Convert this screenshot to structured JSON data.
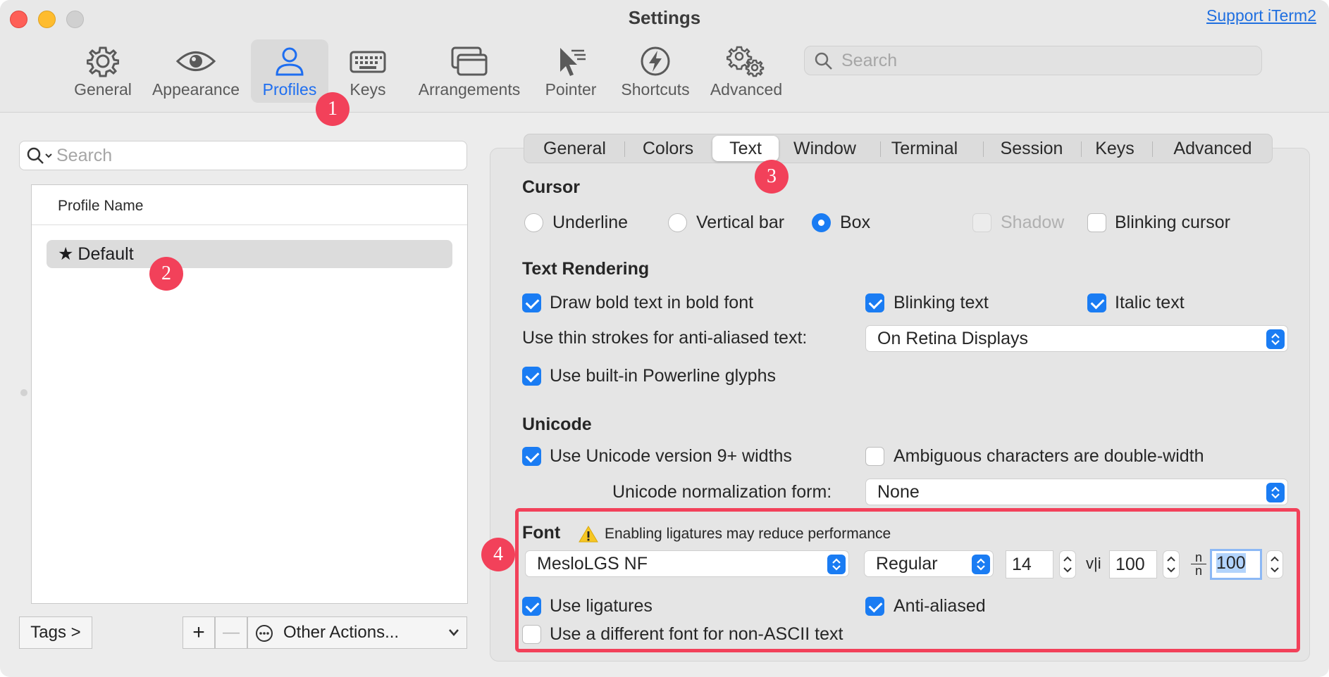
{
  "window": {
    "title": "Settings",
    "support_link": "Support iTerm2"
  },
  "toolbar": {
    "items": [
      {
        "label": "General",
        "icon": "gear-icon"
      },
      {
        "label": "Appearance",
        "icon": "eye-icon"
      },
      {
        "label": "Profiles",
        "icon": "person-icon",
        "active": true
      },
      {
        "label": "Keys",
        "icon": "keyboard-icon"
      },
      {
        "label": "Arrangements",
        "icon": "windows-icon"
      },
      {
        "label": "Pointer",
        "icon": "pointer-icon"
      },
      {
        "label": "Shortcuts",
        "icon": "bolt-icon"
      },
      {
        "label": "Advanced",
        "icon": "gears-icon"
      }
    ],
    "search_placeholder": "Search"
  },
  "annotations": [
    "1",
    "2",
    "3",
    "4"
  ],
  "profiles": {
    "search_placeholder": "Search",
    "column_header": "Profile Name",
    "rows": [
      {
        "name": "Default",
        "default": true
      }
    ],
    "tags_button": "Tags >",
    "add_button": "+",
    "remove_button": "—",
    "other_actions": "Other Actions..."
  },
  "tabs": [
    "General",
    "Colors",
    "Text",
    "Window",
    "Terminal",
    "Session",
    "Keys",
    "Advanced"
  ],
  "active_tab": "Text",
  "cursor": {
    "title": "Cursor",
    "options": [
      "Underline",
      "Vertical bar",
      "Box"
    ],
    "selected": "Box",
    "shadow_label": "Shadow",
    "blinking_label": "Blinking cursor"
  },
  "text_rendering": {
    "title": "Text Rendering",
    "draw_bold": "Draw bold text in bold font",
    "blinking_text": "Blinking text",
    "italic_text": "Italic text",
    "thin_strokes_label": "Use thin strokes for anti-aliased text:",
    "thin_strokes_value": "On Retina Displays",
    "powerline": "Use built-in Powerline glyphs"
  },
  "unicode": {
    "title": "Unicode",
    "version_widths": "Use Unicode version 9+ widths",
    "ambiguous": "Ambiguous characters are double-width",
    "normalization_label": "Unicode normalization form:",
    "normalization_value": "None"
  },
  "font": {
    "title": "Font",
    "warning": "Enabling ligatures may reduce performance",
    "family": "MesloLGS NF",
    "style": "Regular",
    "size": "14",
    "h_spacing_symbol": "v|i",
    "h_spacing": "100",
    "v_spacing_symbol_top": "n",
    "v_spacing_symbol_bottom": "n",
    "v_spacing": "100",
    "ligatures": "Use ligatures",
    "anti_aliased": "Anti-aliased",
    "non_ascii": "Use a different font for non-ASCII text"
  },
  "colors": {
    "accent": "#1a7cf3",
    "annotation": "#f2415a",
    "link": "#1f6fe0"
  }
}
